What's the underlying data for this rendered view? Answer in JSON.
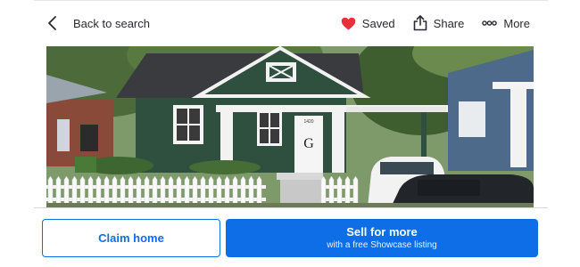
{
  "header": {
    "back_label": "Back to search",
    "actions": [
      {
        "icon": "heart-icon",
        "label": "Saved",
        "color": "#e8303a"
      },
      {
        "icon": "share-icon",
        "label": "Share"
      },
      {
        "icon": "more-icon",
        "label": "More"
      }
    ]
  },
  "photo": {
    "house_number": "1420",
    "door_letter": "G"
  },
  "cta": {
    "claim_label": "Claim home",
    "sell_label": "Sell for more",
    "sell_sub": "with a free Showcase listing"
  },
  "colors": {
    "accent": "#0d6ee8",
    "text": "#2a2a33",
    "saved_heart": "#e8303a"
  }
}
